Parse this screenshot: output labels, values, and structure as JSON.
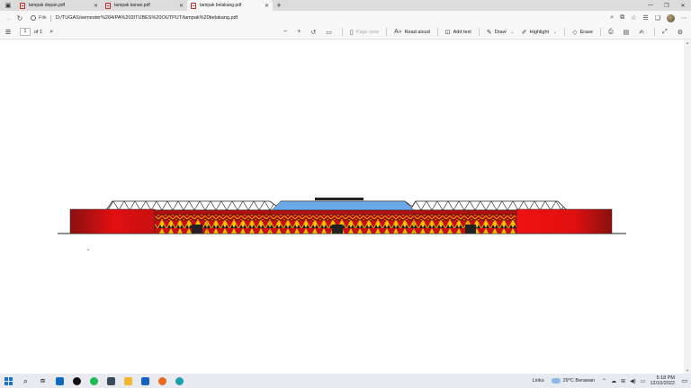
{
  "tabs": [
    {
      "title": "tampak depan.pdf"
    },
    {
      "title": "tampak kanan.pdf"
    },
    {
      "title": "tampak belakang.pdf"
    }
  ],
  "address": {
    "scheme_label": "File",
    "url": "D:/TUGAS/semester%204/PA%203/TUBES%20OUTPUT/tampak%20belakang.pdf"
  },
  "pdf_toolbar": {
    "page_current": "1",
    "page_total": "of 1",
    "page_view": "Page view",
    "read_aloud": "Read aloud",
    "add_text": "Add text",
    "draw": "Draw",
    "highlight": "Highlight",
    "erase": "Erase"
  },
  "taskbar": {
    "links": "Links",
    "weather": "29°C  Berawan",
    "time": "5:18 PM",
    "date": "12/10/2022"
  },
  "colors": {
    "facade_red": "#e01010",
    "facade_dark": "#8a1010",
    "pattern_yellow": "#f2c200",
    "roof_blue": "#6aa8e8"
  }
}
